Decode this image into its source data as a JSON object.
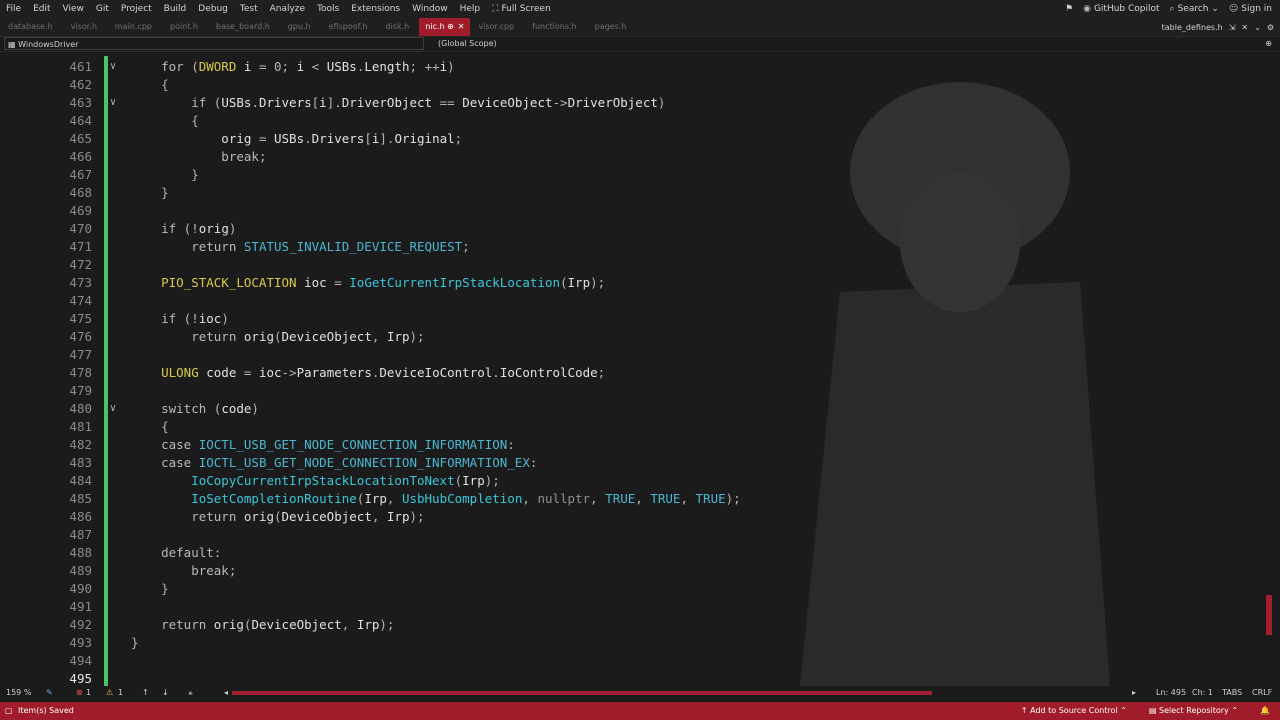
{
  "menu": [
    "File",
    "Edit",
    "View",
    "Git",
    "Project",
    "Build",
    "Debug",
    "Test",
    "Analyze",
    "Tools",
    "Extensions",
    "Window",
    "Help"
  ],
  "fullscreen_label": "Full Screen",
  "copilot_label": "GitHub Copilot",
  "search_label": "Search",
  "signin_label": "Sign in",
  "tabs": [
    "database.h",
    "visor.h",
    "main.cpp",
    "point.h",
    "base_board.h",
    "gpu.h",
    "efispoof.h",
    "disk.h",
    "nic.h",
    "visor.cpp",
    "functions.h",
    "pages.h"
  ],
  "active_tab": "nic.h",
  "active_tab_pin": "⊕",
  "right_tab": "table_defines.h",
  "project": "WindowsDriver",
  "scope": "(Global Scope)",
  "code_lines": [
    {
      "n": "461",
      "fold": "∨",
      "code": [
        [
          "kw",
          "    for ("
        ],
        [
          "ty",
          "DWORD"
        ],
        [
          "id",
          " i "
        ],
        [
          "pu",
          "= 0; "
        ],
        [
          "id",
          "i "
        ],
        [
          "pu",
          "< "
        ],
        [
          "id",
          "USBs"
        ],
        [
          "pu",
          "."
        ],
        [
          "id",
          "Length"
        ],
        [
          "pu",
          "; ++"
        ],
        [
          "id",
          "i"
        ],
        [
          "pu",
          ")"
        ]
      ]
    },
    {
      "n": "462",
      "code": [
        [
          "pu",
          "    {"
        ]
      ]
    },
    {
      "n": "463",
      "fold": "∨",
      "code": [
        [
          "kw",
          "        if ("
        ],
        [
          "id",
          "USBs"
        ],
        [
          "pu",
          "."
        ],
        [
          "id",
          "Drivers"
        ],
        [
          "pu",
          "["
        ],
        [
          "id",
          "i"
        ],
        [
          "pu",
          "]."
        ],
        [
          "id",
          "DriverObject "
        ],
        [
          "pu",
          "== "
        ],
        [
          "id",
          "DeviceObject"
        ],
        [
          "pu",
          "->"
        ],
        [
          "id",
          "DriverObject"
        ],
        [
          "pu",
          ")"
        ]
      ]
    },
    {
      "n": "464",
      "code": [
        [
          "pu",
          "        {"
        ]
      ]
    },
    {
      "n": "465",
      "code": [
        [
          "id",
          "            orig "
        ],
        [
          "pu",
          "= "
        ],
        [
          "id",
          "USBs"
        ],
        [
          "pu",
          "."
        ],
        [
          "id",
          "Drivers"
        ],
        [
          "pu",
          "["
        ],
        [
          "id",
          "i"
        ],
        [
          "pu",
          "]."
        ],
        [
          "id",
          "Original"
        ],
        [
          "pu",
          ";"
        ]
      ]
    },
    {
      "n": "466",
      "code": [
        [
          "kw",
          "            break"
        ],
        [
          "pu",
          ";"
        ]
      ]
    },
    {
      "n": "467",
      "code": [
        [
          "pu",
          "        }"
        ]
      ]
    },
    {
      "n": "468",
      "code": [
        [
          "pu",
          "    }"
        ]
      ]
    },
    {
      "n": "469",
      "code": []
    },
    {
      "n": "470",
      "code": [
        [
          "kw",
          "    if ("
        ],
        [
          "pu",
          "!"
        ],
        [
          "id",
          "orig"
        ],
        [
          "pu",
          ")"
        ]
      ]
    },
    {
      "n": "471",
      "code": [
        [
          "kw",
          "        return "
        ],
        [
          "mac",
          "STATUS_INVALID_DEVICE_REQUEST"
        ],
        [
          "pu",
          ";"
        ]
      ]
    },
    {
      "n": "472",
      "code": []
    },
    {
      "n": "473",
      "code": [
        [
          "ty",
          "    PIO_STACK_LOCATION"
        ],
        [
          "id",
          " ioc "
        ],
        [
          "pu",
          "= "
        ],
        [
          "fn",
          "IoGetCurrentIrpStackLocation"
        ],
        [
          "pu",
          "("
        ],
        [
          "id",
          "Irp"
        ],
        [
          "pu",
          ");"
        ]
      ]
    },
    {
      "n": "474",
      "code": []
    },
    {
      "n": "475",
      "code": [
        [
          "kw",
          "    if ("
        ],
        [
          "pu",
          "!"
        ],
        [
          "id",
          "ioc"
        ],
        [
          "pu",
          ")"
        ]
      ]
    },
    {
      "n": "476",
      "code": [
        [
          "kw",
          "        return "
        ],
        [
          "fnw",
          "orig"
        ],
        [
          "pu",
          "("
        ],
        [
          "id",
          "DeviceObject"
        ],
        [
          "pu",
          ", "
        ],
        [
          "id",
          "Irp"
        ],
        [
          "pu",
          ");"
        ]
      ]
    },
    {
      "n": "477",
      "code": []
    },
    {
      "n": "478",
      "code": [
        [
          "ty",
          "    ULONG"
        ],
        [
          "id",
          " code "
        ],
        [
          "pu",
          "= "
        ],
        [
          "id",
          "ioc"
        ],
        [
          "pu",
          "->"
        ],
        [
          "id",
          "Parameters"
        ],
        [
          "pu",
          "."
        ],
        [
          "id",
          "DeviceIoControl"
        ],
        [
          "pu",
          "."
        ],
        [
          "id",
          "IoControlCode"
        ],
        [
          "pu",
          ";"
        ]
      ]
    },
    {
      "n": "479",
      "code": []
    },
    {
      "n": "480",
      "fold": "∨",
      "code": [
        [
          "kw",
          "    switch ("
        ],
        [
          "id",
          "code"
        ],
        [
          "pu",
          ")"
        ]
      ]
    },
    {
      "n": "481",
      "code": [
        [
          "pu",
          "    {"
        ]
      ]
    },
    {
      "n": "482",
      "code": [
        [
          "kw",
          "    case "
        ],
        [
          "mac",
          "IOCTL_USB_GET_NODE_CONNECTION_INFORMATION"
        ],
        [
          "pu",
          ":"
        ]
      ]
    },
    {
      "n": "483",
      "code": [
        [
          "kw",
          "    case "
        ],
        [
          "mac",
          "IOCTL_USB_GET_NODE_CONNECTION_INFORMATION_EX"
        ],
        [
          "pu",
          ":"
        ]
      ]
    },
    {
      "n": "484",
      "code": [
        [
          "fn",
          "        IoCopyCurrentIrpStackLocationToNext"
        ],
        [
          "pu",
          "("
        ],
        [
          "id",
          "Irp"
        ],
        [
          "pu",
          ");"
        ]
      ]
    },
    {
      "n": "485",
      "code": [
        [
          "fn",
          "        IoSetCompletionRoutine"
        ],
        [
          "pu",
          "("
        ],
        [
          "id",
          "Irp"
        ],
        [
          "pu",
          ", "
        ],
        [
          "fn",
          "UsbHubCompletion"
        ],
        [
          "pu",
          ", "
        ],
        [
          "dim",
          "nullptr"
        ],
        [
          "pu",
          ", "
        ],
        [
          "mac",
          "TRUE"
        ],
        [
          "pu",
          ", "
        ],
        [
          "mac",
          "TRUE"
        ],
        [
          "pu",
          ", "
        ],
        [
          "mac",
          "TRUE"
        ],
        [
          "pu",
          ");"
        ]
      ]
    },
    {
      "n": "486",
      "code": [
        [
          "kw",
          "        return "
        ],
        [
          "fnw",
          "orig"
        ],
        [
          "pu",
          "("
        ],
        [
          "id",
          "DeviceObject"
        ],
        [
          "pu",
          ", "
        ],
        [
          "id",
          "Irp"
        ],
        [
          "pu",
          ");"
        ]
      ]
    },
    {
      "n": "487",
      "code": []
    },
    {
      "n": "488",
      "code": [
        [
          "kw",
          "    default"
        ],
        [
          "pu",
          ":"
        ]
      ]
    },
    {
      "n": "489",
      "code": [
        [
          "kw",
          "        break"
        ],
        [
          "pu",
          ";"
        ]
      ]
    },
    {
      "n": "490",
      "code": [
        [
          "pu",
          "    }"
        ]
      ]
    },
    {
      "n": "491",
      "code": []
    },
    {
      "n": "492",
      "code": [
        [
          "kw",
          "    return "
        ],
        [
          "fnw",
          "orig"
        ],
        [
          "pu",
          "("
        ],
        [
          "id",
          "DeviceObject"
        ],
        [
          "pu",
          ", "
        ],
        [
          "id",
          "Irp"
        ],
        [
          "pu",
          ");"
        ]
      ]
    },
    {
      "n": "493",
      "code": [
        [
          "pu",
          "}"
        ]
      ]
    },
    {
      "n": "494",
      "code": []
    },
    {
      "n": "495",
      "code": [],
      "current": true
    }
  ],
  "zoom": "159 %",
  "errors": "1",
  "warnings": "1",
  "cursor_ln": "Ln: 495",
  "cursor_ch": "Ch: 1",
  "indent": "TABS",
  "eol": "CRLF",
  "status_text": "Item(s) Saved",
  "add_source_control": "Add to Source Control",
  "select_repository": "Select Repository",
  "colors": {
    "accent": "#a01c2a",
    "change": "#4ec06a"
  }
}
